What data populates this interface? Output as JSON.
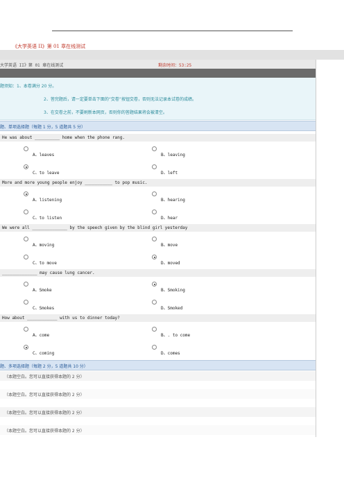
{
  "page_title": "《大学英语 II》第 01 章在线测试",
  "header": {
    "title": "大学英语 II》第 01 章在线测试",
    "time_label": "剩余时间：53:25"
  },
  "notice": {
    "line1": "题须知：1、本卷满分 20 分。",
    "line2": "2、答完题后，请一定要单击下面的“交卷”按钮交卷，否则无法记录本试卷的成绩。",
    "line3": "3、在交卷之前，不要刷新本网页，否则你的答题结果将会被清空。"
  },
  "section1": "题、单项选择题（每题 1 分，5 道题共 5 分）",
  "questions": [
    {
      "text": "He was about __________ home when the phone rang.",
      "options": [
        "A、leaves",
        "B、leaving",
        "C、to leave",
        "D、left"
      ],
      "selected": 2
    },
    {
      "text": "More and more young people enjoy ___________ to pop music.",
      "options": [
        "A、listening",
        "B、hearing",
        "C、to listen",
        "D、hear"
      ],
      "selected": 0
    },
    {
      "text": "We were all ______________ by the speech given by the blind girl yesterday",
      "options": [
        "A、moving",
        "B、move",
        "C、to move",
        "D、moved"
      ],
      "selected": 3
    },
    {
      "text": "______________ may cause lung cancer.",
      "options": [
        "A、Smoke",
        "B、Smoking",
        "C、Smokes",
        "D、Smoked"
      ],
      "selected": 1
    },
    {
      "text": "How about ____________ with us to dinner today?",
      "options": [
        "A、come",
        "B、. to come",
        "C、coming",
        "D、comes"
      ],
      "selected": 2
    }
  ],
  "section2": "题、多项选择题（每题 2 分，5 道题共 10 分）",
  "blanks": [
    "（本题空白。您可以直接获得本题的 2 分）",
    "（本题空白。您可以直接获得本题的 2 分）",
    "（本题空白。您可以直接获得本题的 2 分）",
    "（本题空白。您可以直接获得本题的 2 分）"
  ]
}
